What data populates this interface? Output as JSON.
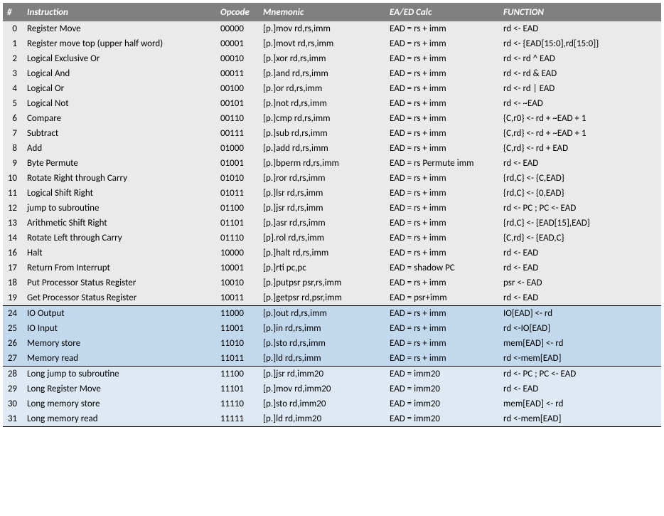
{
  "headers": {
    "num": "#",
    "instr": "Instruction",
    "opcode": "Opcode",
    "mnemonic": "Mnemonic",
    "ea": "EA/ED Calc",
    "func": "FUNCTION"
  },
  "rows": [
    {
      "n": "0",
      "instr": "Register Move",
      "op": "00000",
      "mn": "[p.]mov rd,rs,imm",
      "ea": "EAD = rs + imm",
      "fn": "rd <- EAD",
      "g": "a"
    },
    {
      "n": "1",
      "instr": "Register move top (upper half word)",
      "op": "00001",
      "mn": "[p.]movt rd,rs,imm",
      "ea": "EAD = rs + imm",
      "fn": "rd <- {EAD[15:0],rd[15:0]}",
      "g": "a"
    },
    {
      "n": "2",
      "instr": "Logical Exclusive Or",
      "op": "00010",
      "mn": "[p.]xor rd,rs,imm",
      "ea": "EAD = rs + imm",
      "fn": "rd <- rd ^ EAD",
      "g": "a"
    },
    {
      "n": "3",
      "instr": "Logical And",
      "op": "00011",
      "mn": "[p.]and rd,rs,imm",
      "ea": "EAD = rs + imm",
      "fn": "rd <- rd & EAD",
      "g": "a"
    },
    {
      "n": "4",
      "instr": "Logical Or",
      "op": "00100",
      "mn": "[p.]or rd,rs,imm",
      "ea": "EAD = rs + imm",
      "fn": "rd <- rd | EAD",
      "g": "a"
    },
    {
      "n": "5",
      "instr": "Logical Not",
      "op": "00101",
      "mn": "[p.]not rd,rs,imm",
      "ea": "EAD = rs + imm",
      "fn": "rd <- ~EAD",
      "g": "a"
    },
    {
      "n": "6",
      "instr": "Compare",
      "op": "00110",
      "mn": "[p.]cmp rd,rs,imm",
      "ea": "EAD = rs + imm",
      "fn": "{C,r0} <- rd + ~EAD + 1",
      "g": "a"
    },
    {
      "n": "7",
      "instr": "Subtract",
      "op": "00111",
      "mn": "[p.]sub rd,rs,imm",
      "ea": "EAD = rs + imm",
      "fn": "{C,rd} <- rd + ~EAD + 1",
      "g": "a"
    },
    {
      "n": "8",
      "instr": "Add",
      "op": "01000",
      "mn": "[p.]add rd,rs,imm",
      "ea": "EAD = rs + imm",
      "fn": "{C,rd}  <- rd + EAD",
      "g": "a"
    },
    {
      "n": "9",
      "instr": "Byte Permute",
      "op": "01001",
      "mn": "[p.]bperm rd,rs,imm",
      "ea": "EAD = rs Permute imm",
      "fn": "rd <- EAD",
      "g": "a"
    },
    {
      "n": "10",
      "instr": "Rotate Right through Carry",
      "op": "01010",
      "mn": "[p.]ror rd,rs,imm",
      "ea": "EAD = rs + imm",
      "fn": "{rd,C} <- {C,EAD}",
      "g": "a"
    },
    {
      "n": "11",
      "instr": "Logical Shift Right",
      "op": "01011",
      "mn": "[p.]lsr rd,rs,imm",
      "ea": "EAD = rs + imm",
      "fn": "{rd,C} <- {0,EAD}",
      "g": "a"
    },
    {
      "n": "12",
      "instr": "jump to subroutine",
      "op": "01100",
      "mn": "[p.]jsr  rd,rs,imm",
      "ea": "EAD = rs + imm",
      "fn": "rd <- PC ; PC <- EAD",
      "g": "a"
    },
    {
      "n": "13",
      "instr": "Arithmetic Shift Right",
      "op": "01101",
      "mn": "[p.]asr rd,rs,imm",
      "ea": "EAD = rs + imm",
      "fn": "{rd,C} <- {EAD[15],EAD}",
      "g": "a"
    },
    {
      "n": "14",
      "instr": "Rotate Left through Carry",
      "op": "01110",
      "mn": "[p].rol rd,rs,imm",
      "ea": "EAD = rs + imm",
      "fn": "{C,rd} <- {EAD,C}",
      "g": "a"
    },
    {
      "n": "16",
      "instr": "Halt",
      "op": "10000",
      "mn": "[p.]halt rd,rs,imm",
      "ea": "EAD = rs + imm",
      "fn": "rd <- EAD",
      "g": "a"
    },
    {
      "n": "17",
      "instr": "Return From Interrupt",
      "op": "10001",
      "mn": "[p.]rti pc,pc",
      "ea": "EAD = shadow PC",
      "fn": "rd <- EAD",
      "g": "a"
    },
    {
      "n": "18",
      "instr": "Put Processor Status Register",
      "op": "10010",
      "mn": "[p.]putpsr psr,rs,imm",
      "ea": "EAD = rs + imm",
      "fn": "psr <- EAD",
      "g": "a"
    },
    {
      "n": "19",
      "instr": "Get Processor Status Register",
      "op": "10011",
      "mn": "[p.]getpsr rd,psr,imm",
      "ea": "EAD = psr+imm",
      "fn": "rd <- EAD",
      "g": "a"
    },
    {
      "n": "24",
      "instr": "IO Output",
      "op": "11000",
      "mn": "[p.]out rd,rs,imm",
      "ea": "EAD = rs + imm",
      "fn": "IO[EAD] <- rd",
      "g": "b"
    },
    {
      "n": "25",
      "instr": "IO Input",
      "op": "11001",
      "mn": "[p.]in rd,rs,imm",
      "ea": "EAD = rs + imm",
      "fn": "rd <-IO[EAD]",
      "g": "b"
    },
    {
      "n": "26",
      "instr": "Memory store",
      "op": "11010",
      "mn": "[p.]sto rd,rs,imm",
      "ea": "EAD = rs + imm",
      "fn": "mem[EAD] <- rd",
      "g": "b"
    },
    {
      "n": "27",
      "instr": "Memory read",
      "op": "11011",
      "mn": "[p.]ld rd,rs,imm",
      "ea": "EAD = rs + imm",
      "fn": "rd <-mem[EAD]",
      "g": "b"
    },
    {
      "n": "28",
      "instr": "Long jump to subroutine",
      "op": "11100",
      "mn": "[p.]jsr rd,imm20",
      "ea": "EAD = imm20",
      "fn": "rd <- PC ; PC <- EAD",
      "g": "c"
    },
    {
      "n": "29",
      "instr": "Long Register Move",
      "op": "11101",
      "mn": "[p.]mov rd,imm20",
      "ea": "EAD = imm20",
      "fn": "rd <- EAD",
      "g": "c"
    },
    {
      "n": "30",
      "instr": "Long memory store",
      "op": "11110",
      "mn": "[p.]sto rd,imm20",
      "ea": "EAD = imm20",
      "fn": "mem[EAD] <- rd",
      "g": "c"
    },
    {
      "n": "31",
      "instr": "Long memory read",
      "op": "11111",
      "mn": "[p.]ld rd,imm20",
      "ea": "EAD = imm20",
      "fn": "rd <-mem[EAD]",
      "g": "c"
    }
  ]
}
